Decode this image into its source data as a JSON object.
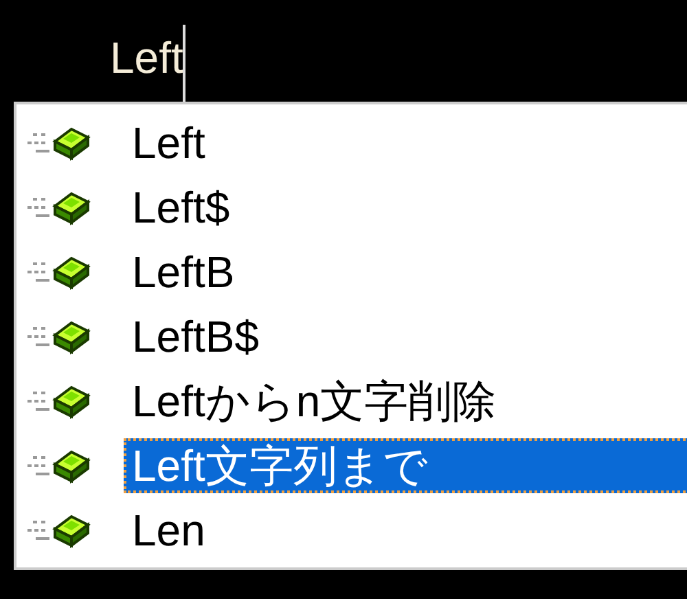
{
  "editor": {
    "typed_text": "Left"
  },
  "completion_list": {
    "items": [
      {
        "label": "Left",
        "selected": false
      },
      {
        "label": "Left$",
        "selected": false
      },
      {
        "label": "LeftB",
        "selected": false
      },
      {
        "label": "LeftB$",
        "selected": false
      },
      {
        "label": "Leftからn文字削除",
        "selected": false
      },
      {
        "label": "Left文字列まで",
        "selected": true
      },
      {
        "label": "Len",
        "selected": false
      }
    ]
  }
}
